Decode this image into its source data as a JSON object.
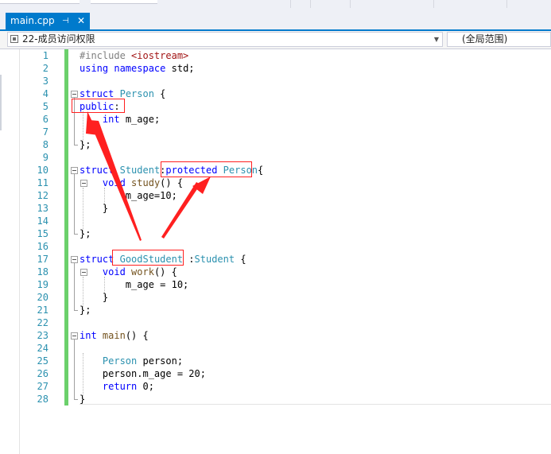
{
  "tab": {
    "filename": "main.cpp",
    "pin_glyph": "⊣",
    "close_glyph": "✕"
  },
  "navbar": {
    "scope_left": "22-成员访问权限",
    "scope_right": "(全局范围)"
  },
  "colors": {
    "accent": "#007acc",
    "keyword": "#0000ff",
    "type": "#2b91af",
    "string": "#a31515",
    "annotation": "#ff2020"
  },
  "code": {
    "lines": [
      {
        "n": "1",
        "t": "#include <iostream>"
      },
      {
        "n": "2",
        "t": "using namespace std;"
      },
      {
        "n": "3",
        "t": ""
      },
      {
        "n": "4",
        "t": "struct Person {"
      },
      {
        "n": "5",
        "t": "public:"
      },
      {
        "n": "6",
        "t": "    int m_age;"
      },
      {
        "n": "7",
        "t": ""
      },
      {
        "n": "8",
        "t": "};"
      },
      {
        "n": "9",
        "t": ""
      },
      {
        "n": "10",
        "t": "struct Student:protected Person{"
      },
      {
        "n": "11",
        "t": "    void study() {"
      },
      {
        "n": "12",
        "t": "        m_age=10;"
      },
      {
        "n": "13",
        "t": "    }"
      },
      {
        "n": "14",
        "t": ""
      },
      {
        "n": "15",
        "t": "};"
      },
      {
        "n": "16",
        "t": ""
      },
      {
        "n": "17",
        "t": "struct GoodStudent :Student {"
      },
      {
        "n": "18",
        "t": "    void work() {"
      },
      {
        "n": "19",
        "t": "        m_age = 10;"
      },
      {
        "n": "20",
        "t": "    }"
      },
      {
        "n": "21",
        "t": "};"
      },
      {
        "n": "22",
        "t": ""
      },
      {
        "n": "23",
        "t": "int main() {"
      },
      {
        "n": "24",
        "t": ""
      },
      {
        "n": "25",
        "t": "    Person person;"
      },
      {
        "n": "26",
        "t": "    person.m_age = 20;"
      },
      {
        "n": "27",
        "t": "    return 0;"
      },
      {
        "n": "28",
        "t": "}"
      }
    ]
  }
}
